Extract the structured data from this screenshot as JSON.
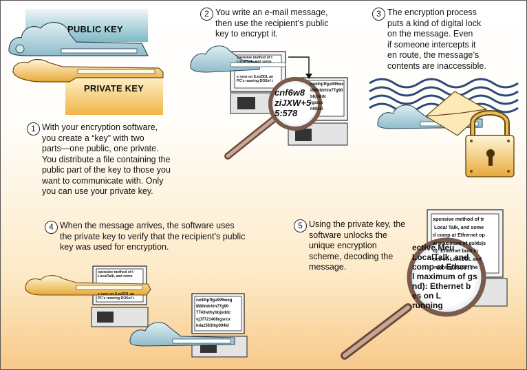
{
  "keys": {
    "public_label": "PUBLIC KEY",
    "private_label": "PRIVATE KEY"
  },
  "steps": [
    {
      "number": "1",
      "text": "With your encryption software,\nyou create a “key” with two\nparts—one public, one private.\nYou distribute a file containing the\npublic part of the key to those you\nwant to communicate with. Only\nyou can use your private key."
    },
    {
      "number": "2",
      "text": "You write an e-mail message,\nthen use the recipient’s public\nkey to encrypt it."
    },
    {
      "number": "3",
      "text": "The encryption process\nputs a kind of digital lock\non the message. Even\nif someone intercepts it\nen route, the message’s\ncontents are inaccessible."
    },
    {
      "number": "4",
      "text": "When the message arrives, the software uses\nthe private key to verify that the recipient’s public\nkey was used for encryption."
    },
    {
      "number": "5",
      "text": "Using the private key, the\nsoftware unlocks the\nunique encryption\nscheme, decoding the\nmessage."
    }
  ],
  "screens": {
    "step2_plain": "xpensive method of t\nLocalTalk, and some\n",
    "step2_plain2": "s runs on ILexDDL an\nPC's running DOSef t",
    "step2_cipher": "rw4lhpffgu995weg\ni880ddrhin77g90\nbbjoddc\nrgsrcx\nh004kl",
    "step2_magnified": "cnf6w8\nziJXW+5\n5:578",
    "step4_plain": "xpensive method of t\nLocalTalk, and some",
    "step4_plain2": "s runs on ILexDDL an\nPC's running DOSef t",
    "step4_cipher": "rw4lhpffgu995weg\ni880ddrhin77g90\n7743wthybbjoddc\nvjJ7721408rgsrcx\nkdaz563thp004kl",
    "step5_plain": "xpensive method of tr\n Local Talk, and some\nd comp at Ethernet op\nal maximum of gslds|s\nd): Ethernet built in\noes on LexxDDL and\n running DOSef the",
    "step5_magnified": "ective Meu\nLocalTalk, and\ncomp at Ethern\nl maximum of gs\nnd): Ethernet b\nes on L\nrunning"
  }
}
